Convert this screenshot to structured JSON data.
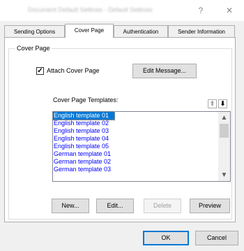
{
  "window": {
    "title": "Document Default Settings  -  Default Settings",
    "help_label": "?",
    "close_label": "✕"
  },
  "tabs": [
    {
      "label": "Sending Options"
    },
    {
      "label": "Cover Page"
    },
    {
      "label": "Authentication"
    },
    {
      "label": "Sender Information"
    }
  ],
  "cover_page": {
    "group_label": "Cover Page",
    "attach_label": "Attach Cover Page",
    "attach_checked_mark": "✓",
    "edit_message_label": "Edit Message...",
    "templates_label": "Cover Page Templates:",
    "sort_up_label": "⬆",
    "sort_down_label": "⬇",
    "templates": [
      "English template 01",
      "English template 02",
      "English template 03",
      "English template 04",
      "English template 05",
      "German template 01",
      "German template 02",
      "German template 03"
    ],
    "selected_index": 0,
    "scroll_up": "▲",
    "scroll_down": "▼",
    "buttons": {
      "new": "New...",
      "edit": "Edit...",
      "delete": "Delete",
      "preview": "Preview"
    }
  },
  "footer": {
    "ok": "OK",
    "cancel": "Cancel"
  },
  "colors": {
    "selection": "#0078d7",
    "list_text": "#0000ff"
  }
}
